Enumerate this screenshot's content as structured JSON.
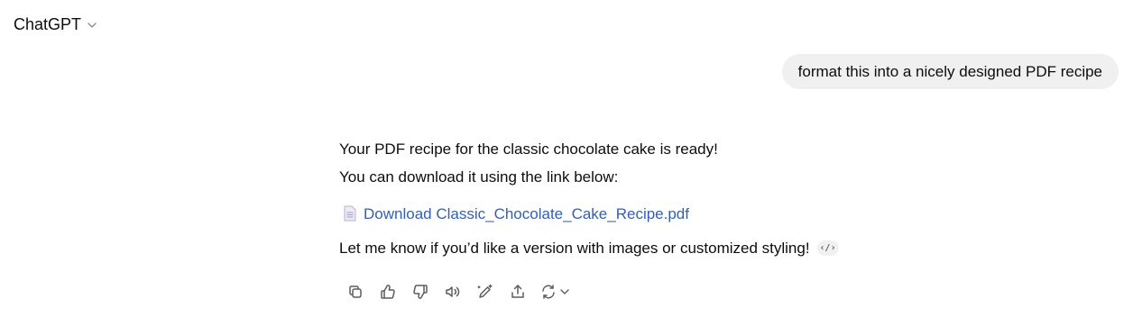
{
  "header": {
    "model_name": "ChatGPT",
    "chevron": "chevron-down-icon"
  },
  "user_message": {
    "text": "format this into a nicely designed PDF recipe"
  },
  "assistant_message": {
    "line1": "Your PDF recipe for the classic chocolate cake is ready!",
    "line2": "You can download it using the link below:",
    "file_link": {
      "icon": "document-icon",
      "label": "Download Classic_Chocolate_Cake_Recipe.pdf",
      "color": "#3560b0"
    },
    "closing": "Let me know if you’d like a version with images or customized styling!",
    "code_chip": "‹/›"
  },
  "toolbar": {
    "buttons": [
      {
        "name": "copy-icon"
      },
      {
        "name": "thumbs-up-icon"
      },
      {
        "name": "thumbs-down-icon"
      },
      {
        "name": "read-aloud-icon"
      },
      {
        "name": "edit-canvas-icon"
      },
      {
        "name": "share-icon"
      },
      {
        "name": "regenerate-icon"
      }
    ]
  },
  "colors": {
    "bubble_bg": "#f0f0f0",
    "text": "#0d0d0d",
    "icon": "#5d5d5d"
  }
}
